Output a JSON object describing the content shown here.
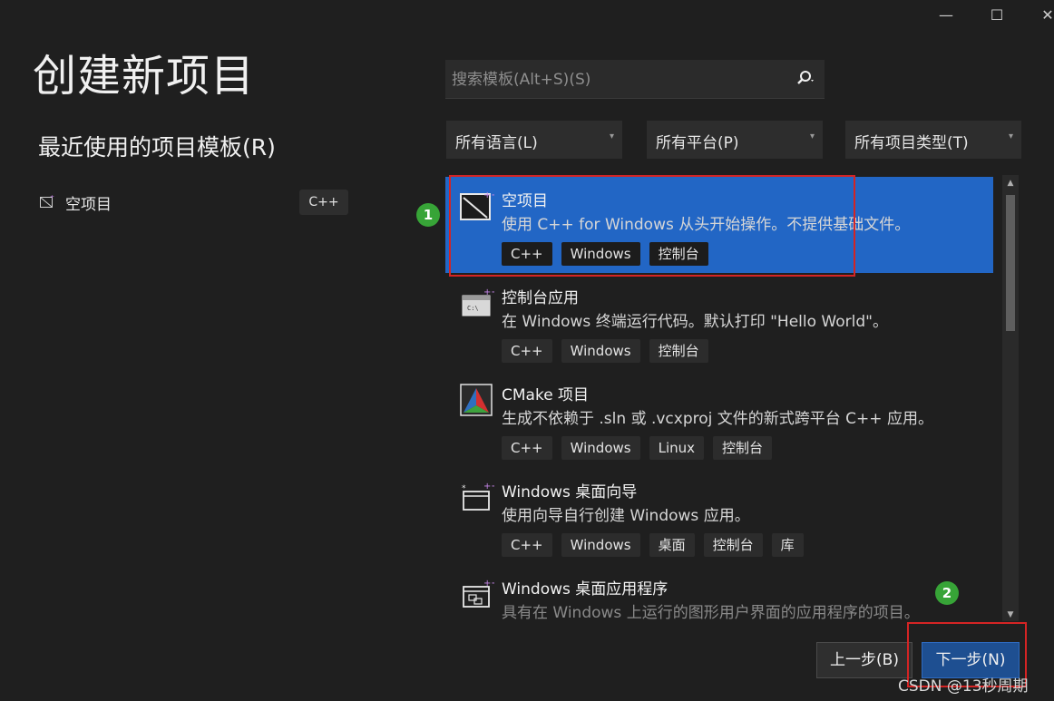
{
  "window": {
    "minimize_glyph": "—",
    "maximize_glyph": "☐",
    "close_glyph": "✕"
  },
  "page": {
    "title": "创建新项目"
  },
  "recent": {
    "heading": "最近使用的项目模板(R)",
    "items": [
      {
        "label": "空项目",
        "tag": "C++",
        "icon": "empty-project-icon"
      }
    ]
  },
  "search": {
    "placeholder": "搜索模板(Alt+S)(S)",
    "icon": "search-icon"
  },
  "filters": [
    {
      "label": "所有语言(L)"
    },
    {
      "label": "所有平台(P)"
    },
    {
      "label": "所有项目类型(T)"
    }
  ],
  "templates": [
    {
      "name": "空项目",
      "description": "使用 C++ for Windows 从头开始操作。不提供基础文件。",
      "tags": [
        "C++",
        "Windows",
        "控制台"
      ],
      "selected": true,
      "icon": "empty-project-icon"
    },
    {
      "name": "控制台应用",
      "description": "在 Windows 终端运行代码。默认打印 \"Hello World\"。",
      "tags": [
        "C++",
        "Windows",
        "控制台"
      ],
      "selected": false,
      "icon": "console-app-icon"
    },
    {
      "name": "CMake 项目",
      "description": "生成不依赖于 .sln 或 .vcxproj 文件的新式跨平台 C++ 应用。",
      "tags": [
        "C++",
        "Windows",
        "Linux",
        "控制台"
      ],
      "selected": false,
      "icon": "cmake-icon"
    },
    {
      "name": "Windows 桌面向导",
      "description": "使用向导自行创建 Windows 应用。",
      "tags": [
        "C++",
        "Windows",
        "桌面",
        "控制台",
        "库"
      ],
      "selected": false,
      "icon": "desktop-wizard-icon"
    },
    {
      "name": "Windows 桌面应用程序",
      "description": "具有在 Windows 上运行的图形用户界面的应用程序的项目。",
      "tags": [],
      "selected": false,
      "icon": "desktop-app-icon"
    }
  ],
  "annotations": {
    "badge1": "1",
    "badge2": "2"
  },
  "buttons": {
    "back": "上一步(B)",
    "next": "下一步(N)"
  },
  "watermark": "CSDN @13秒周期",
  "colors": {
    "background": "#1f1f1f",
    "selected": "#2266c5",
    "highlight_box": "#d42424",
    "badge": "#37a437",
    "primary_button": "#1e4f91"
  }
}
